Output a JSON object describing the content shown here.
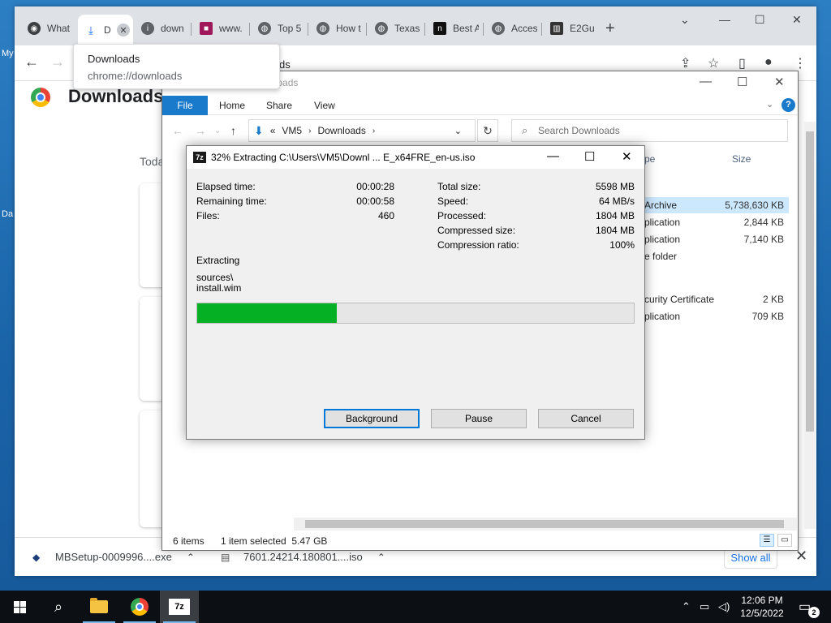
{
  "desktop": {
    "label_top": "My",
    "label_bottom": "Da"
  },
  "chrome": {
    "tabs": [
      {
        "label": "What",
        "fav_color": "#3c4043",
        "icon": "chrome-icon"
      },
      {
        "label": "Downloads",
        "fav_color": "#1a73e8",
        "icon": "download-icon"
      },
      {
        "label": "down",
        "fav_color": "#5f6368",
        "icon": "info-icon"
      },
      {
        "label": "www.",
        "fav_color": "#a0185a",
        "icon": "site-icon"
      },
      {
        "label": "Top 5",
        "fav_color": "#5f6368",
        "icon": "globe-icon"
      },
      {
        "label": "How t",
        "fav_color": "#5f6368",
        "icon": "globe-icon"
      },
      {
        "label": "Texas",
        "fav_color": "#5f6368",
        "icon": "globe-icon"
      },
      {
        "label": "Best A",
        "fav_color": "#111111",
        "icon": "site-icon"
      },
      {
        "label": "Acces",
        "fav_color": "#5f6368",
        "icon": "globe-icon"
      },
      {
        "label": "E2Gu",
        "fav_color": "#333333",
        "icon": "bank-icon"
      }
    ],
    "active_tab_short": "D",
    "tooltip": {
      "title": "Downloads",
      "url": "chrome://downloads"
    },
    "omnibox_suffix": "ds",
    "page_title": "Downloads",
    "today_label": "Toda",
    "shelf": {
      "items": [
        {
          "name": "MBSetup-0009996....exe"
        },
        {
          "name": "7601.24214.180801....iso"
        }
      ],
      "show_all": "Show all"
    }
  },
  "explorer": {
    "title": "Downloads",
    "ribbon": {
      "file": "File",
      "home": "Home",
      "share": "Share",
      "view": "View"
    },
    "address": {
      "root": "«",
      "part1": "VM5",
      "part2": "Downloads"
    },
    "search_placeholder": "Search Downloads",
    "columns": {
      "type": "pe",
      "size": "Size"
    },
    "rows": [
      {
        "type": "Archive",
        "size": "5,738,630 KB",
        "selected": true
      },
      {
        "type": "plication",
        "size": "2,844 KB",
        "selected": false
      },
      {
        "type": "plication",
        "size": "7,140 KB",
        "selected": false
      },
      {
        "type": "e folder",
        "size": "",
        "selected": false
      },
      {
        "type": "curity Certificate",
        "size": "2 KB",
        "selected": false
      },
      {
        "type": "plication",
        "size": "709 KB",
        "selected": false
      }
    ],
    "status": {
      "count": "6 items",
      "selection": "1 item selected  5.47 GB"
    }
  },
  "zip": {
    "title": "32% Extracting C:\\Users\\VM5\\Downl ... E_x64FRE_en-us.iso",
    "left_stats": [
      {
        "label": "Elapsed time:",
        "value": "00:00:28"
      },
      {
        "label": "Remaining time:",
        "value": "00:00:58"
      },
      {
        "label": "Files:",
        "value": "460"
      }
    ],
    "right_stats": [
      {
        "label": "Total size:",
        "value": "5598 MB"
      },
      {
        "label": "Speed:",
        "value": "64 MB/s"
      },
      {
        "label": "Processed:",
        "value": "1804 MB"
      },
      {
        "label": "Compressed size:",
        "value": "1804 MB"
      },
      {
        "label": "Compression ratio:",
        "value": "100%"
      }
    ],
    "extracting_label": "Extracting",
    "current_path": "sources\\",
    "current_file": "install.wim",
    "progress_fraction": 0.32,
    "buttons": {
      "background": "Background",
      "pause": "Pause",
      "cancel": "Cancel"
    },
    "progress_color": "#06b025"
  },
  "taskbar": {
    "time": "12:06 PM",
    "date": "12/5/2022",
    "notification_count": "2",
    "zip_label": "7z"
  }
}
